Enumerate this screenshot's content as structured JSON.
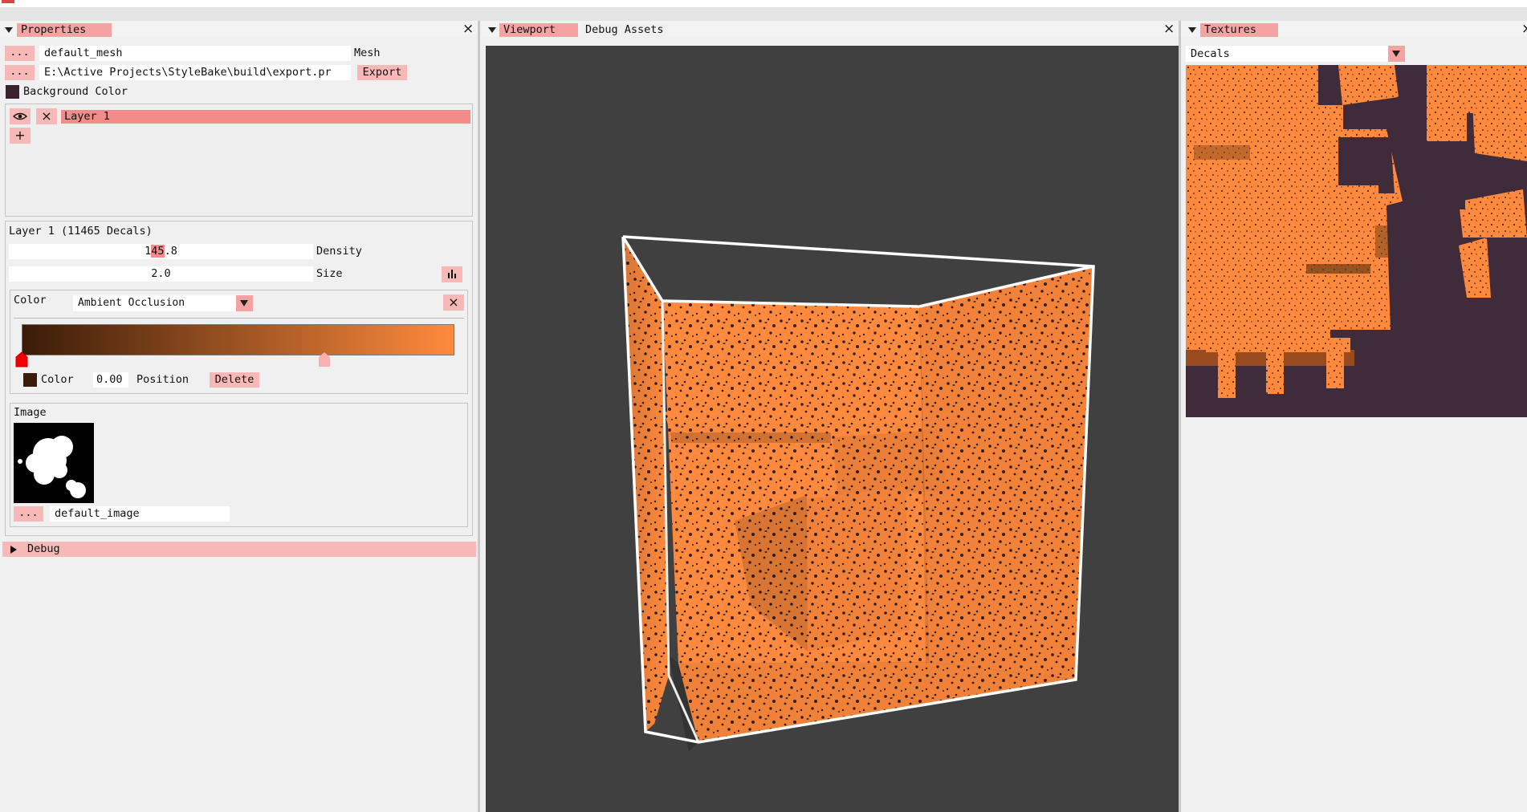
{
  "properties": {
    "tab": "Properties",
    "mesh_browse": "...",
    "mesh_name": "default_mesh",
    "mesh_label": "Mesh",
    "export_browse": "...",
    "export_path": "E:\\Active Projects\\StyleBake\\build\\export.pr",
    "export_button": "Export",
    "background_color_label": "Background Color",
    "layer_name": "Layer 1",
    "add_layer": "+",
    "layer_settings_title": "Layer 1 (11465 Decals)",
    "density_pre": "1",
    "density_sel": "45",
    "density_post": ".8",
    "density_label": "Density",
    "size_value": "2.0",
    "size_label": "Size",
    "color_label": "Color",
    "color_mode": "Ambient Occlusion",
    "gradient_colors": [
      "#3a1c08",
      "#ff8a3d"
    ],
    "stop_color_label": "Color",
    "stop_position_value": "0.00",
    "stop_position_label": "Position",
    "delete_button": "Delete",
    "image_label": "Image",
    "image_browse": "...",
    "image_name": "default_image",
    "debug_label": "Debug"
  },
  "viewport": {
    "tabs": [
      "Viewport",
      "Debug Assets"
    ]
  },
  "textures": {
    "tab": "Textures",
    "selected": "Decals"
  },
  "colors": {
    "accent": "#f4a3a3",
    "orange": "#ff8a3d",
    "viewport_bg": "#404040",
    "texture_dark": "#402b3a"
  }
}
